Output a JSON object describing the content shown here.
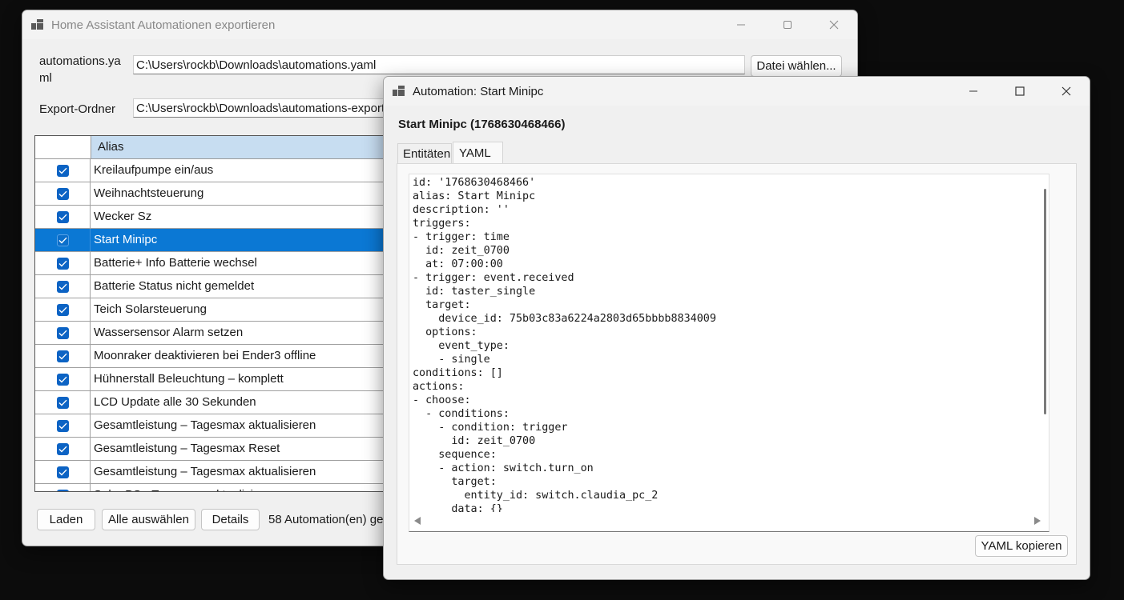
{
  "main_window": {
    "title": "Home Assistant Automationen exportieren",
    "automations_label": "automations.ya\nml",
    "automations_path": "C:\\Users\\rockb\\Downloads\\automations.yaml",
    "choose_file_button": "Datei wählen...",
    "export_label": "Export-Ordner",
    "export_path": "C:\\Users\\rockb\\Downloads\\automations-export",
    "grid": {
      "header_alias": "Alias",
      "rows": [
        {
          "alias": "Kreilaufpumpe ein/aus",
          "checked": true,
          "selected": false
        },
        {
          "alias": "Weihnachtsteuerung",
          "checked": true,
          "selected": false
        },
        {
          "alias": "Wecker Sz",
          "checked": true,
          "selected": false
        },
        {
          "alias": "Start Minipc",
          "checked": true,
          "selected": true
        },
        {
          "alias": "Batterie+ Info Batterie wechsel",
          "checked": true,
          "selected": false
        },
        {
          "alias": "Batterie Status nicht gemeldet",
          "checked": true,
          "selected": false
        },
        {
          "alias": "Teich Solarsteuerung",
          "checked": true,
          "selected": false
        },
        {
          "alias": "Wassersensor Alarm setzen",
          "checked": true,
          "selected": false
        },
        {
          "alias": "Moonraker deaktivieren bei Ender3 offline",
          "checked": true,
          "selected": false
        },
        {
          "alias": "Hühnerstall Beleuchtung – komplett",
          "checked": true,
          "selected": false
        },
        {
          "alias": "LCD Update alle 30 Sekunden",
          "checked": true,
          "selected": false
        },
        {
          "alias": "Gesamtleistung – Tagesmax aktualisieren",
          "checked": true,
          "selected": false
        },
        {
          "alias": "Gesamtleistung – Tagesmax Reset",
          "checked": true,
          "selected": false
        },
        {
          "alias": "Gesamtleistung – Tagesmax aktualisieren",
          "checked": true,
          "selected": false
        },
        {
          "alias": "Solar PS - Tagesmax aktualisieren",
          "checked": true,
          "selected": false
        }
      ]
    },
    "load_button": "Laden",
    "select_all_button": "Alle auswählen",
    "details_button": "Details",
    "status_text": "58 Automation(en) ge"
  },
  "detail_window": {
    "title": "Automation: Start Minipc",
    "heading": "Start Minipc (1768630468466)",
    "tabs": [
      "Entitäten",
      "YAML"
    ],
    "active_tab": "YAML",
    "yaml_lines": [
      "id: '1768630468466'",
      "alias: Start Minipc",
      "description: ''",
      "triggers:",
      "- trigger: time",
      "  id: zeit_0700",
      "  at: 07:00:00",
      "- trigger: event.received",
      "  id: taster_single",
      "  target:",
      "    device_id: 75b03c83a6224a2803d65bbbb8834009",
      "  options:",
      "    event_type:",
      "    - single",
      "conditions: []",
      "actions:",
      "- choose:",
      "  - conditions:",
      "    - condition: trigger",
      "      id: zeit_0700",
      "    sequence:",
      "    - action: switch.turn_on",
      "      target:",
      "        entity_id: switch.claudia_pc_2",
      "      data: {}"
    ],
    "copy_button": "YAML kopieren"
  },
  "icons": {
    "app": "app-icon",
    "minimize": "minimize-icon",
    "maximize": "maximize-icon",
    "close": "close-icon",
    "checkbox": "checkbox-checked-icon",
    "scroll_left": "scroll-left-arrow-icon",
    "scroll_right": "scroll-right-arrow-icon"
  },
  "colors": {
    "selection": "#0b78d4",
    "header": "#c7ddf1",
    "checkbox": "#0c63c4"
  }
}
